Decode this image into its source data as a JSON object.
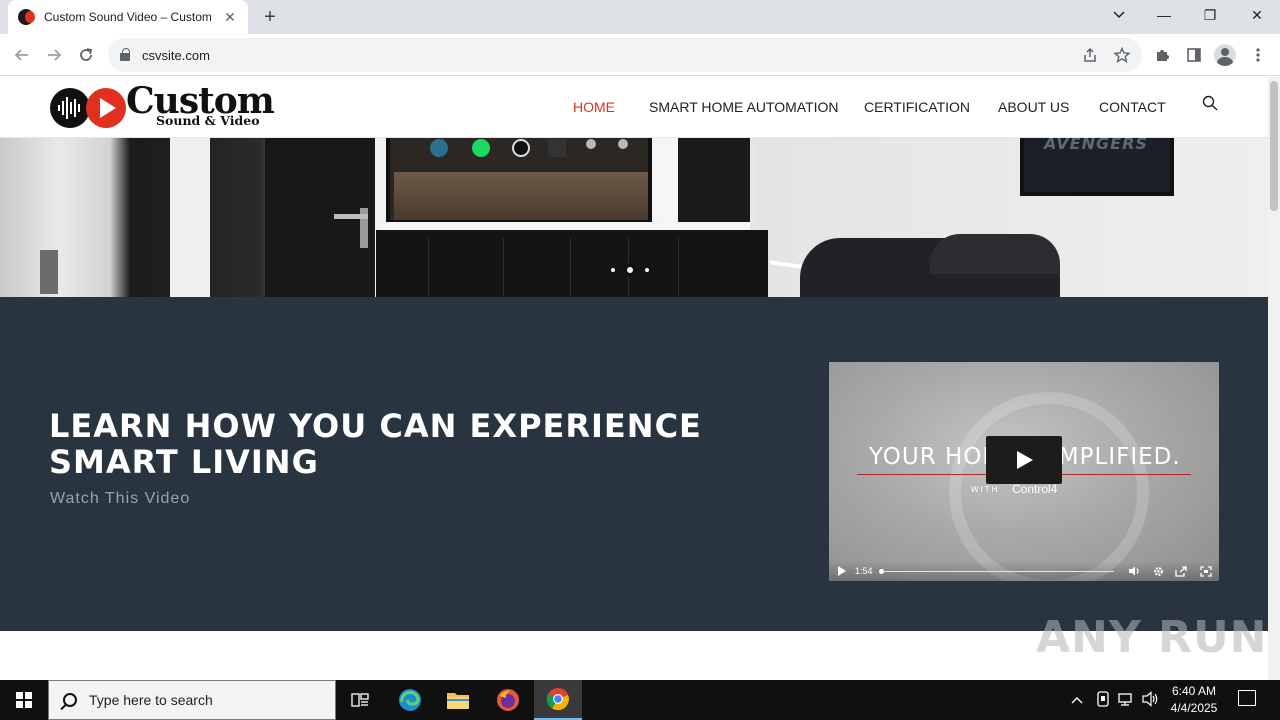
{
  "browser": {
    "tab_title": "Custom Sound Video – Custom",
    "tab_close": "✕",
    "new_tab": "+",
    "url": "csvsite.com",
    "window_controls": {
      "minimize": "—",
      "restore": "❐",
      "close": "✕"
    }
  },
  "site": {
    "logo": {
      "word": "Custom",
      "sub": "Sound & Video"
    },
    "nav": [
      {
        "label": "HOME",
        "active": true
      },
      {
        "label": "SMART HOME AUTOMATION",
        "active": false
      },
      {
        "label": "CERTIFICATION",
        "active": false
      },
      {
        "label": "ABOUT US",
        "active": false
      },
      {
        "label": "CONTACT",
        "active": false
      }
    ],
    "hero": {
      "poster_text": "AVENGERS",
      "slide_dots": 3,
      "active_dot": 2
    },
    "video_section": {
      "title": "LEARN HOW YOU CAN EXPERIENCE SMART LIVING",
      "subtitle": "Watch This Video",
      "player": {
        "headline": "YOUR HOME, SIMPLIFIED.",
        "with": "WITH",
        "brand": "Control4",
        "duration": "1:54"
      }
    }
  },
  "watermark": "ANY RUN",
  "taskbar": {
    "search_placeholder": "Type here to search",
    "time": "6:40 AM",
    "date": "4/4/2025"
  },
  "colors": {
    "accent": "#d9361b",
    "section_bg": "#283540",
    "logo_red": "#e0301e"
  }
}
